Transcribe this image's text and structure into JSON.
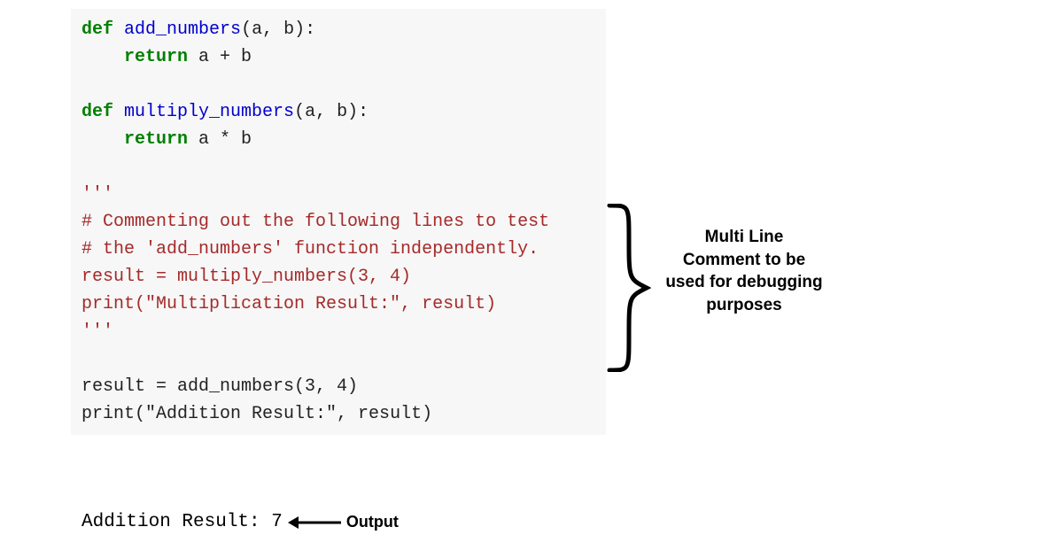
{
  "code": {
    "l1_def": "def",
    "l1_fn": "add_numbers",
    "l1_rest": "(a, b):",
    "l2_ret": "return",
    "l2_rest": " a + b",
    "l4_def": "def",
    "l4_fn": "multiply_numbers",
    "l4_rest": "(a, b):",
    "l5_ret": "return",
    "l5_rest": " a * b",
    "l7": "'''",
    "l8": "# Commenting out the following lines to test",
    "l9": "# the 'add_numbers' function independently.",
    "l10": "result = multiply_numbers(3, 4)",
    "l11": "print(\"Multiplication Result:\", result)",
    "l12": "'''",
    "l14": "result = add_numbers(3, 4)",
    "l15a": "print",
    "l15b": "(\"Addition Result:\", result)"
  },
  "output": {
    "text": "Addition Result: 7",
    "label": "Output"
  },
  "annotation": {
    "text": "Multi Line Comment to be used for debugging purposes"
  }
}
